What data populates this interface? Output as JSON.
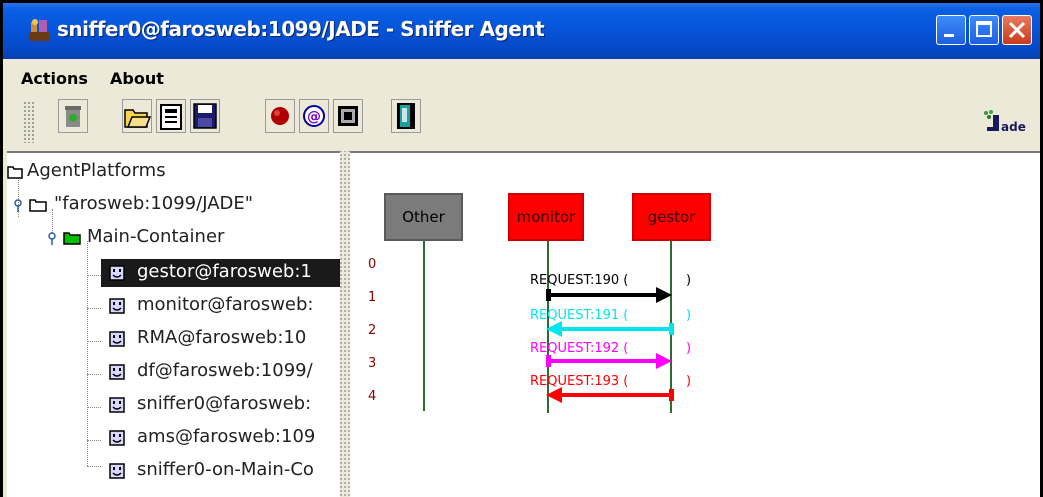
{
  "window": {
    "title": "sniffer0@farosweb:1099/JADE - Sniffer Agent"
  },
  "menu": {
    "items": [
      "Actions",
      "About"
    ]
  },
  "toolbar": {
    "buttons": [
      "trash-icon",
      "open-folder-icon",
      "add-agent-icon",
      "save-icon",
      "record-icon",
      "snoop-icon",
      "window-icon",
      "exit-door-icon"
    ]
  },
  "tree": {
    "root": "AgentPlatforms",
    "platform": "\"farosweb:1099/JADE\"",
    "container": "Main-Container",
    "agents": [
      "gestor@farosweb:1",
      "monitor@farosweb:",
      "RMA@farosweb:10",
      "df@farosweb:1099/",
      "sniffer0@farosweb:",
      "ams@farosweb:109",
      "sniffer0-on-Main-Co"
    ],
    "selected_index": 0
  },
  "sniffer": {
    "agents": [
      "Other",
      "monitor",
      "gestor"
    ],
    "indices": [
      "0",
      "1",
      "2",
      "3",
      "4"
    ],
    "messages": [
      {
        "label": "REQUEST:190 (",
        "close": ")",
        "color": "#000000",
        "from": "monitor",
        "to": "gestor"
      },
      {
        "label": "REQUEST:191 (",
        "close": ")",
        "color": "#00e5ee",
        "from": "gestor",
        "to": "monitor"
      },
      {
        "label": "REQUEST:192 (",
        "close": ")",
        "color": "#ff00ff",
        "from": "monitor",
        "to": "gestor"
      },
      {
        "label": "REQUEST:193 (",
        "close": ")",
        "color": "#ff0000",
        "from": "gestor",
        "to": "monitor"
      }
    ],
    "colors": {
      "other_box": "#7b7b7b",
      "agent_box": "#ff0000",
      "lifeline": "#2e6b2e",
      "index": "#8b0000"
    }
  }
}
